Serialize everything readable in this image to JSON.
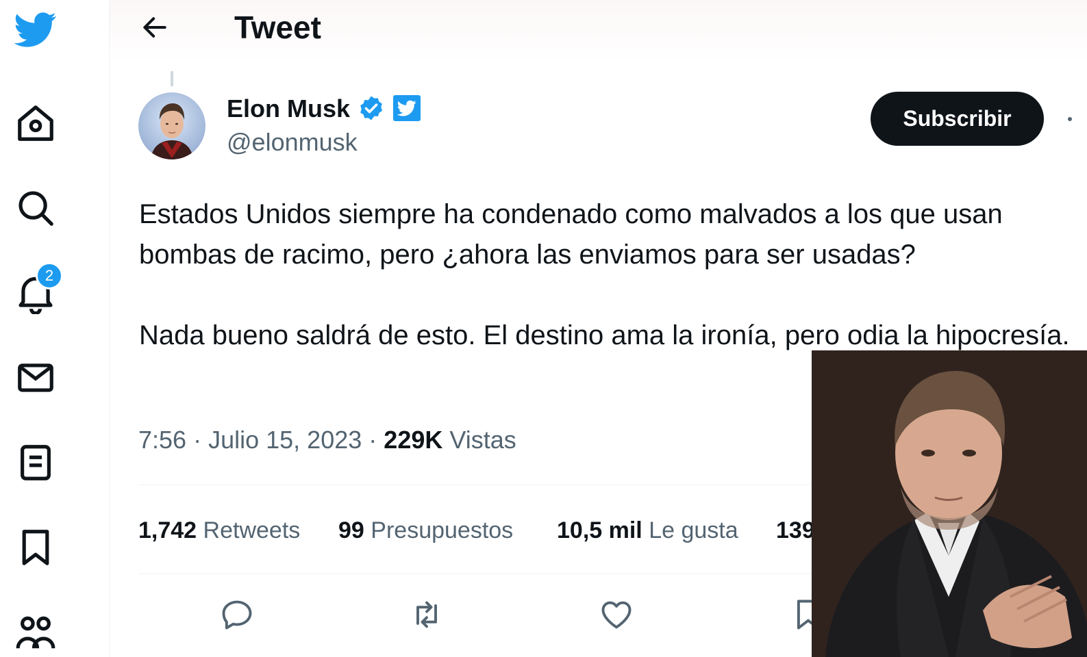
{
  "sidebar": {
    "logo": "twitter-bird-icon",
    "items": [
      {
        "name": "home",
        "icon": "home-icon"
      },
      {
        "name": "explore",
        "icon": "search-icon"
      },
      {
        "name": "notifications",
        "icon": "bell-icon",
        "badge": "2"
      },
      {
        "name": "messages",
        "icon": "mail-icon"
      },
      {
        "name": "lists",
        "icon": "list-icon"
      },
      {
        "name": "bookmarks",
        "icon": "bookmark-icon"
      },
      {
        "name": "communities",
        "icon": "people-icon"
      }
    ]
  },
  "header": {
    "back_icon": "arrow-left-icon",
    "title": "Tweet"
  },
  "tweet": {
    "author": {
      "name": "Elon Musk",
      "handle": "@elonmusk",
      "verified_icon": "verified-badge-icon",
      "affiliate_icon": "twitter-affiliate-icon"
    },
    "subscribe_label": "Subscribir",
    "text": "Estados Unidos siempre ha condenado como malvados a los que usan bombas de racimo, pero ¿ahora las enviamos para ser usadas?\n\nNada bueno saldrá de esto. El destino ama la ironía, pero odia la hipocresía.",
    "time": "7:56",
    "date": "Julio 15, 2023",
    "views_count": "229K",
    "views_label": "Vistas",
    "stats": {
      "retweets_count": "1,742",
      "retweets_label": "Retweets",
      "quotes_count": "99",
      "quotes_label": "Presupuestos",
      "likes_count": "10,5 mil",
      "likes_label": "Le gusta",
      "bookmarks_count_partial": "139"
    },
    "actions": [
      {
        "name": "reply",
        "icon": "reply-icon"
      },
      {
        "name": "retweet",
        "icon": "retweet-icon"
      },
      {
        "name": "like",
        "icon": "heart-icon"
      },
      {
        "name": "bookmark",
        "icon": "bookmark-icon"
      }
    ]
  },
  "colors": {
    "accent": "#1d9bf0",
    "text_primary": "#0f1419",
    "text_secondary": "#536471",
    "button_dark": "#0f1419",
    "divider": "#eff3f4"
  }
}
